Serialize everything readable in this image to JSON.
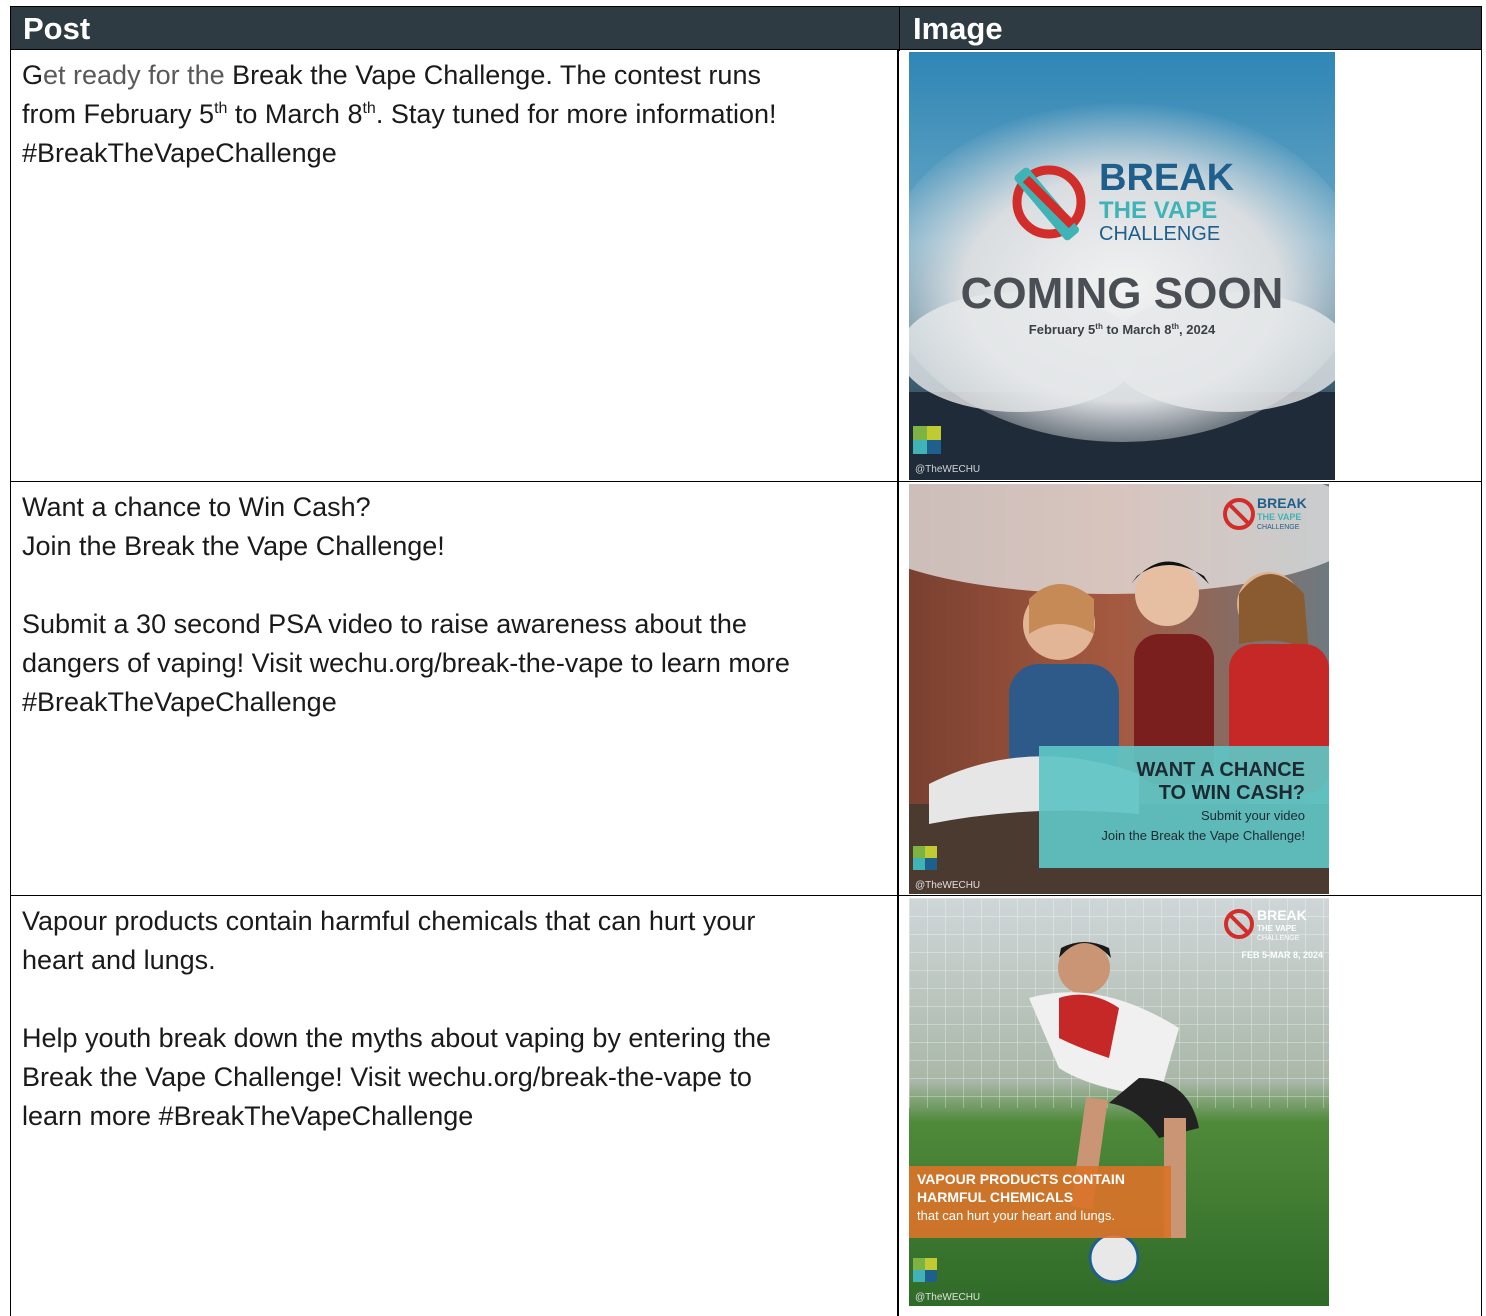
{
  "table": {
    "headers": [
      "Post",
      "Image"
    ],
    "rows": [
      {
        "post": {
          "lead_dark": "G",
          "lead_muted": "et ready for the",
          "line1_rest": " Break the Vape Challenge. The contest runs",
          "line2_a": "from February 5",
          "sup1": "th",
          "line2_b": " to March 8",
          "sup2": "th",
          "line2_c": ". Stay tuned for more information!",
          "line3": "#BreakTheVapeChallenge"
        },
        "image": {
          "brand_break": "BREAK",
          "brand_the_vape": "THE VAPE",
          "brand_challenge": "CHALLENGE",
          "headline": "COMING SOON",
          "dates_a": "February 5",
          "dates_sup1": "th",
          "dates_b": " to March 8",
          "dates_sup2": "th",
          "dates_c": ", 2024",
          "handle": "@TheWECHU"
        }
      },
      {
        "post": {
          "line1": "Want a chance to Win Cash?",
          "line2": "Join the Break the Vape Challenge!",
          "line3": "Submit a 30 second PSA video to raise awareness about the",
          "line4": "dangers of vaping! Visit wechu.org/break-the-vape to learn more",
          "line5": "#BreakTheVapeChallenge"
        },
        "image": {
          "brand_break": "BREAK",
          "brand_the_vape": "THE VAPE",
          "brand_challenge": "CHALLENGE",
          "headline1": "WANT A CHANCE",
          "headline2": "TO WIN CASH?",
          "sub1": "Submit your video",
          "sub2": "Join the Break the Vape Challenge!",
          "handle": "@TheWECHU"
        }
      },
      {
        "post": {
          "line1": "Vapour products contain harmful chemicals that can hurt your",
          "line2": "heart and lungs.",
          "line3": "Help youth break down the myths about vaping by entering the",
          "line4": "Break the Vape Challenge! Visit wechu.org/break-the-vape to",
          "line5": "learn more #BreakTheVapeChallenge"
        },
        "image": {
          "brand_break": "BREAK",
          "brand_the_vape": "THE VAPE",
          "brand_challenge": "CHALLENGE",
          "dates": "FEB 5-MAR 8, 2024",
          "headline1": "VAPOUR PRODUCTS CONTAIN",
          "headline2": "HARMFUL CHEMICALS",
          "sub": "that can hurt your heart and lungs.",
          "handle": "@TheWECHU"
        }
      }
    ]
  },
  "colors": {
    "header_bg": "#2e3b43",
    "brand_blue": "#1f5f8b",
    "brand_teal": "#3fb3b5",
    "brand_red": "#d12d2a",
    "orange": "#d9732a"
  }
}
